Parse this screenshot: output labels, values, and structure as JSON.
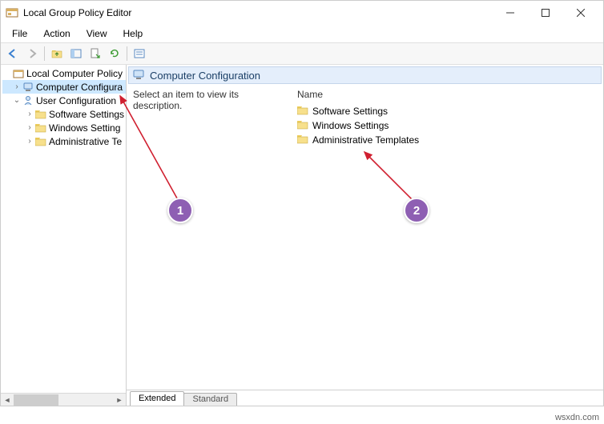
{
  "window": {
    "title": "Local Group Policy Editor"
  },
  "menubar": {
    "items": [
      "File",
      "Action",
      "View",
      "Help"
    ]
  },
  "tree": {
    "root": {
      "label": "Local Computer Policy",
      "expander": " "
    },
    "computer": {
      "label": "Computer Configura",
      "expander": "›"
    },
    "user": {
      "label": "User Configuration",
      "expander": "⌄"
    },
    "user_children": {
      "software": "Software Settings",
      "windows": "Windows Setting",
      "admin": "Administrative Te"
    }
  },
  "details": {
    "header": "Computer Configuration",
    "description": "Select an item to view its description.",
    "name_header": "Name",
    "items": {
      "software": "Software Settings",
      "windows": "Windows Settings",
      "admin": "Administrative Templates"
    }
  },
  "tabs": {
    "extended": "Extended",
    "standard": "Standard"
  },
  "badges": {
    "one": "1",
    "two": "2"
  },
  "watermark": "wsxdn.com"
}
